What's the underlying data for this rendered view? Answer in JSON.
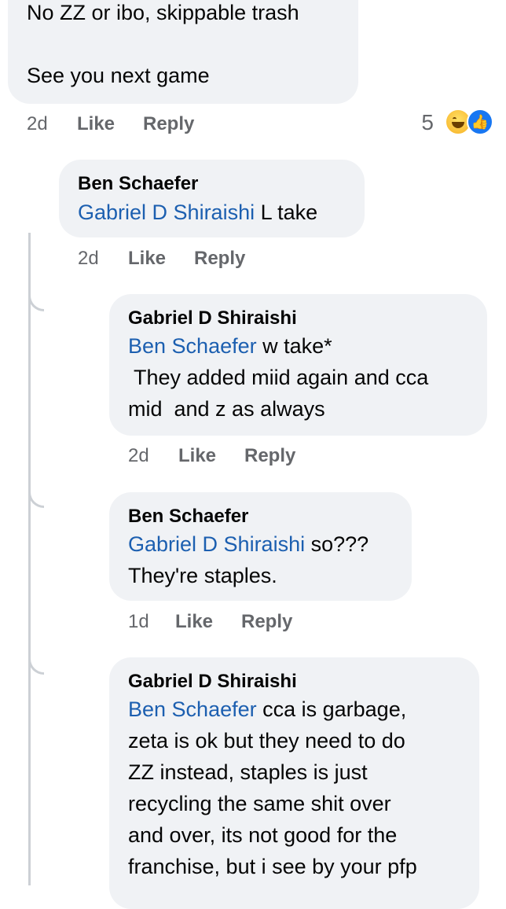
{
  "top_comment": {
    "text_line1": "No ZZ or ibo, skippable trash",
    "text_line2": "See you next game",
    "time": "2d",
    "like": "Like",
    "reply": "Reply",
    "reaction_count": "5",
    "reactions": [
      "haha-icon",
      "like-icon"
    ]
  },
  "replies": [
    {
      "author": "Ben Schaefer",
      "mention": "Gabriel D Shiraishi",
      "text": " L take",
      "time": "2d",
      "like": "Like",
      "reply": "Reply"
    },
    {
      "author": "Gabriel D Shiraishi",
      "mention": "Ben Schaefer",
      "text": " w take*",
      "lines": [
        " They added miid again and cca",
        "mid  and z as always"
      ],
      "time": "2d",
      "like": "Like",
      "reply": "Reply"
    },
    {
      "author": "Ben Schaefer",
      "mention": "Gabriel D Shiraishi",
      "text": " so???",
      "lines": [
        "They're staples."
      ],
      "time": "1d",
      "like": "Like",
      "reply": "Reply"
    },
    {
      "author": "Gabriel D Shiraishi",
      "mention": "Ben Schaefer",
      "text": " cca is garbage,",
      "lines": [
        "zeta is ok but they need to do",
        "ZZ instead, staples is just",
        "recycling the same shit over",
        "and over, its not good for the",
        "franchise, but i see by your pfp"
      ]
    }
  ],
  "colors": {
    "bubble": "#f0f2f5",
    "mention": "#1c5fb0",
    "meta": "#65676b"
  }
}
